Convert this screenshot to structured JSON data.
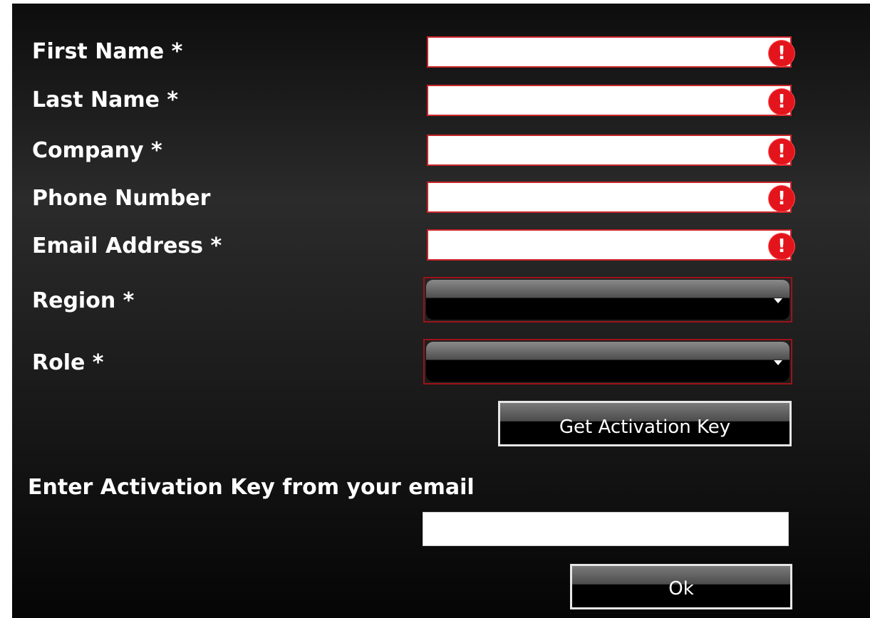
{
  "form": {
    "fields": [
      {
        "label": "First Name *",
        "value": "",
        "error_icon": "exclamation-icon"
      },
      {
        "label": "Last Name *",
        "value": "",
        "error_icon": "exclamation-icon"
      },
      {
        "label": "Company *",
        "value": "",
        "error_icon": "exclamation-icon"
      },
      {
        "label": "Phone Number",
        "value": "",
        "error_icon": "exclamation-icon"
      },
      {
        "label": "Email Address *",
        "value": "",
        "error_icon": "exclamation-icon"
      }
    ],
    "error_glyph": "!",
    "region": {
      "label": "Region *",
      "value": ""
    },
    "role": {
      "label": "Role *",
      "value": ""
    },
    "get_key_button": "Get Activation Key",
    "activation": {
      "label": "Enter Activation Key from your email",
      "value": ""
    },
    "ok_button": "Ok"
  },
  "colors": {
    "error_border": "#c8242a",
    "error_icon": "#e3141c",
    "background": "#1c1c1c",
    "text": "#ffffff"
  }
}
